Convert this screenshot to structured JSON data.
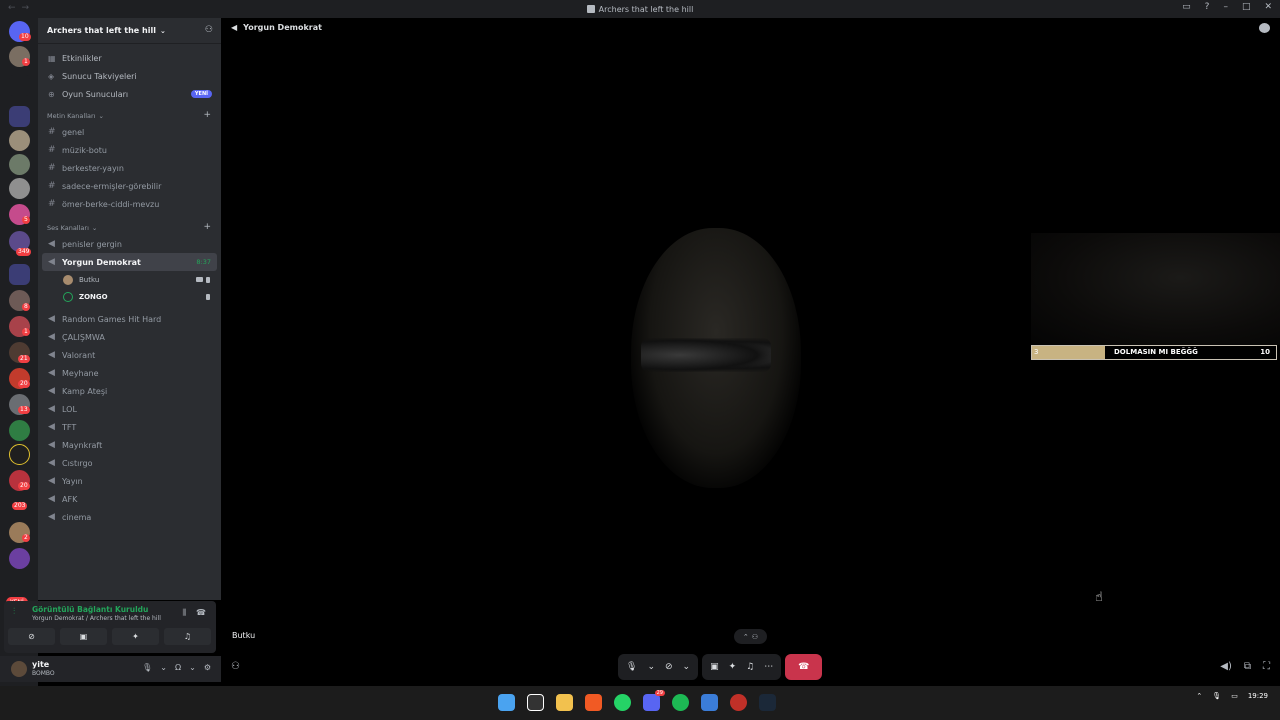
{
  "window": {
    "title": "Archers that left the hill"
  },
  "guilds": {
    "badges": [
      "10",
      "1",
      "5",
      "349",
      "8",
      "1",
      "21",
      "20",
      "13",
      "20",
      "203",
      "2"
    ],
    "new_label": "YENİ"
  },
  "server": {
    "name": "Archers that left the hill",
    "menu": [
      {
        "icon": "calendar-icon",
        "label": "Etkinlikler"
      },
      {
        "icon": "boost-icon",
        "label": "Sunucu Takviyeleri"
      },
      {
        "icon": "gamepad-icon",
        "label": "Oyun Sunucuları",
        "badge": "YENİ"
      }
    ],
    "text_category": "Metin Kanalları",
    "text_channels": [
      "genel",
      "müzik-botu",
      "berkester-yayın",
      "sadece-ermişler-görebilir",
      "ömer-berke-ciddi-mevzu"
    ],
    "voice_category": "Ses Kanalları",
    "voice_channels_top": [
      "penisler gergin"
    ],
    "active_channel": {
      "name": "Yorgun Demokrat",
      "time": "8:37"
    },
    "members": [
      {
        "name": "Butku",
        "camera": true
      },
      {
        "name": "ZONGO",
        "camera": false
      }
    ],
    "voice_channels_rest": [
      "Random Games Hit Hard",
      "ÇALIŞMWA",
      "Valorant",
      "Meyhane",
      "Kamp Ateşi",
      "LOL",
      "TFT",
      "Maynkraft",
      "Cıstırgo",
      "Yayın",
      "AFK",
      "cinema"
    ]
  },
  "voice_panel": {
    "status": "Görüntülü Bağlantı Kuruldu",
    "location": "Yorgun Demokrat / Archers that left the hill"
  },
  "user": {
    "name": "yite",
    "status": "BOMBO"
  },
  "stage": {
    "channel_name": "Yorgun Demokrat",
    "caller_name": "Butku",
    "overlay": {
      "left": "3",
      "text": "DOLMASIN MI BEĞĞĞ",
      "right": "10",
      "progress_fraction": 0.3
    }
  },
  "taskbar": {
    "discord_badge": "29",
    "time": "19:29"
  },
  "colors": {
    "accent": "#5865f2",
    "green": "#23a55a",
    "red": "#c9344c"
  }
}
